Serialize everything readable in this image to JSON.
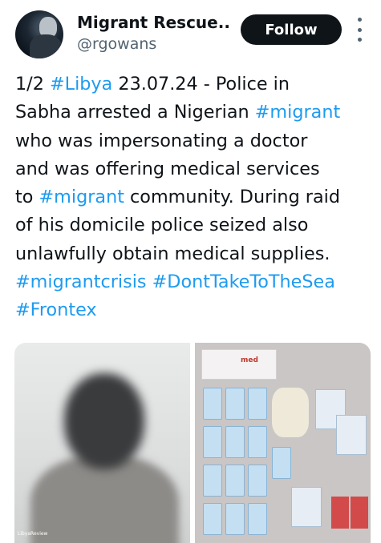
{
  "account": {
    "name": "Migrant Rescue...",
    "handle": "@rgowans",
    "follow_label": "Follow"
  },
  "tweet": {
    "lines": [
      [
        {
          "t": "1/2 ",
          "tag": false
        },
        {
          "t": "#Libya",
          "tag": true
        },
        {
          "t": " 23.07.24 - Police in",
          "tag": false
        }
      ],
      [
        {
          "t": "Sabha arrested a Nigerian ",
          "tag": false
        },
        {
          "t": "#migrant",
          "tag": true
        }
      ],
      [
        {
          "t": "who was impersonating a doctor",
          "tag": false
        }
      ],
      [
        {
          "t": "and was offering medical services",
          "tag": false
        }
      ],
      [
        {
          "t": "to ",
          "tag": false
        },
        {
          "t": "#migrant",
          "tag": true
        },
        {
          "t": " community. During raid",
          "tag": false
        }
      ],
      [
        {
          "t": "of his domicile police seized also",
          "tag": false
        }
      ],
      [
        {
          "t": "unlawfully obtain medical supplies.",
          "tag": false
        }
      ],
      [
        {
          "t": "#migrantcrisis",
          "tag": true
        },
        {
          "t": " ",
          "tag": false
        },
        {
          "t": "#DontTakeToTheSea",
          "tag": true
        }
      ],
      [
        {
          "t": "#Frontex",
          "tag": true
        }
      ]
    ]
  },
  "media": {
    "left_watermark": "LibyaReview",
    "right_box_label": "med"
  },
  "colors": {
    "hashtag": "#1d9bf0",
    "button_bg": "#0f1419",
    "secondary_text": "#536471"
  }
}
